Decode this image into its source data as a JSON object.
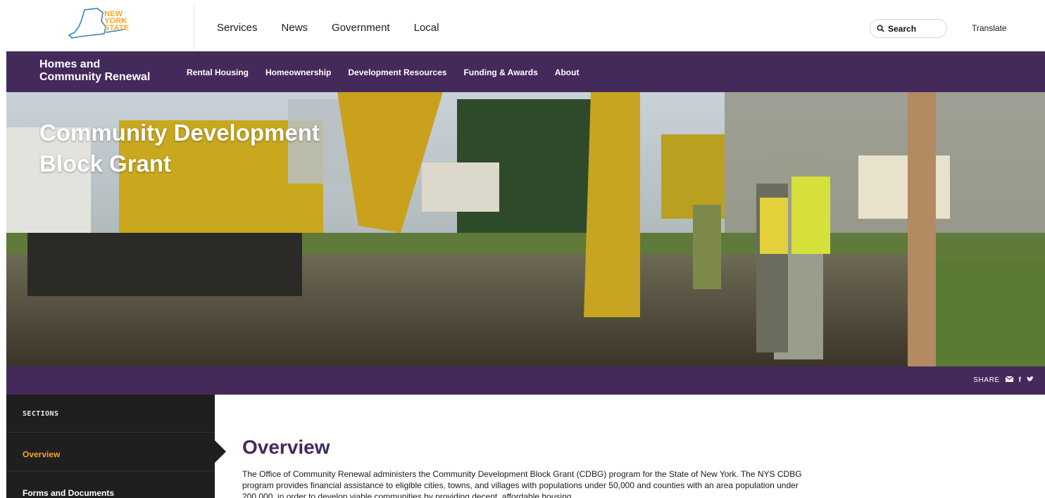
{
  "logo": {
    "line1": "NEW",
    "line2": "YORK",
    "line3": "STATE"
  },
  "topnav": {
    "items": [
      "Services",
      "News",
      "Government",
      "Local"
    ]
  },
  "search": {
    "label": "Search"
  },
  "translate": {
    "label": "Translate"
  },
  "agency": {
    "title_line1": "Homes and",
    "title_line2": "Community Renewal",
    "nav": [
      "Rental Housing",
      "Homeownership",
      "Development Resources",
      "Funding & Awards",
      "About"
    ]
  },
  "hero": {
    "title_line1": "Community Development",
    "title_line2": "Block Grant"
  },
  "share": {
    "label": "SHARE"
  },
  "sidebar": {
    "heading": "SECTIONS",
    "items": [
      {
        "label": "Overview",
        "active": true
      },
      {
        "label": "Forms and Documents",
        "active": false
      }
    ]
  },
  "content": {
    "title": "Overview",
    "body": "The Office of Community Renewal administers the Community Development Block Grant (CDBG) program for the State of New York. The NYS CDBG program provides financial assistance to eligible cities, towns, and villages with populations under 50,000 and counties with an area population under 200,000, in order to develop viable communities by providing decent, affordable housing,"
  },
  "colors": {
    "brand_purple": "#432a5b",
    "accent_gold": "#f5a623",
    "sidebar_bg": "#1f1f1f"
  }
}
